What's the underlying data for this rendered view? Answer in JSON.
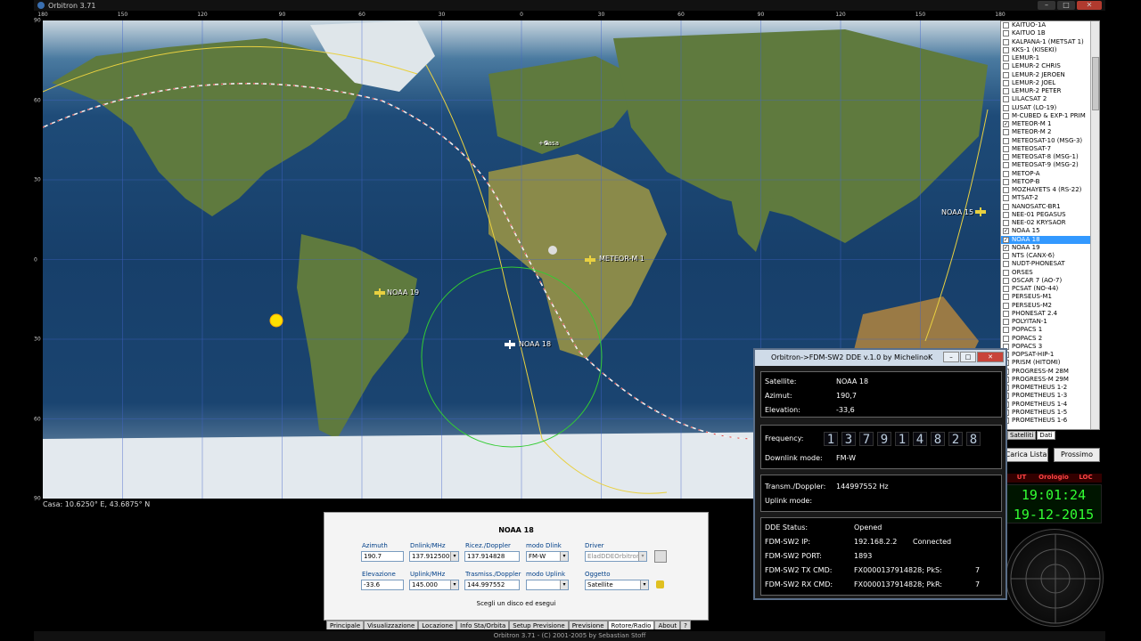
{
  "window": {
    "title": "Orbitron 3.71"
  },
  "lon_ticks": [
    "180",
    "150",
    "120",
    "90",
    "60",
    "30",
    "0",
    "30",
    "60",
    "90",
    "120",
    "150",
    "180"
  ],
  "lat_ticks": [
    "90",
    "60",
    "30",
    "0",
    "30",
    "60",
    "90"
  ],
  "satellites_on_map": [
    {
      "name": "NOAA 19",
      "color": "#f0e030"
    },
    {
      "name": "NOAA 18",
      "color": "#ffffff"
    },
    {
      "name": "METEOR-M 1",
      "color": "#f0e030"
    },
    {
      "name": "NOAA 15",
      "color": "#f0e030"
    }
  ],
  "home_label": "+Casa",
  "casa_status": "Casa: 10.6250° E, 43.6875° N",
  "sat_list": [
    {
      "name": "KAITUO-1A",
      "checked": false
    },
    {
      "name": "KAITUO 1B",
      "checked": false
    },
    {
      "name": "KALPANA-1 (METSAT 1)",
      "checked": false
    },
    {
      "name": "KKS-1 (KISEKI)",
      "checked": false
    },
    {
      "name": "LEMUR-1",
      "checked": false
    },
    {
      "name": "LEMUR-2 CHRIS",
      "checked": false
    },
    {
      "name": "LEMUR-2 JEROEN",
      "checked": false
    },
    {
      "name": "LEMUR-2 JOEL",
      "checked": false
    },
    {
      "name": "LEMUR-2 PETER",
      "checked": false
    },
    {
      "name": "LILACSAT 2",
      "checked": false
    },
    {
      "name": "LUSAT (LO-19)",
      "checked": false
    },
    {
      "name": "M-CUBED & EXP-1 PRIM",
      "checked": false
    },
    {
      "name": "METEOR-M 1",
      "checked": true
    },
    {
      "name": "METEOR-M 2",
      "checked": false
    },
    {
      "name": "METEOSAT-10 (MSG-3)",
      "checked": false
    },
    {
      "name": "METEOSAT-7",
      "checked": false
    },
    {
      "name": "METEOSAT-8 (MSG-1)",
      "checked": false
    },
    {
      "name": "METEOSAT-9 (MSG-2)",
      "checked": false
    },
    {
      "name": "METOP-A",
      "checked": false
    },
    {
      "name": "METOP-B",
      "checked": false
    },
    {
      "name": "MOZHAYETS 4 (RS-22)",
      "checked": false
    },
    {
      "name": "MTSAT-2",
      "checked": false
    },
    {
      "name": "NANOSATC-BR1",
      "checked": false
    },
    {
      "name": "NEE-01 PEGASUS",
      "checked": false
    },
    {
      "name": "NEE-02 KRYSAOR",
      "checked": false
    },
    {
      "name": "NOAA 15",
      "checked": true
    },
    {
      "name": "NOAA 18",
      "checked": true,
      "selected": true
    },
    {
      "name": "NOAA 19",
      "checked": true
    },
    {
      "name": "NTS (CANX-6)",
      "checked": false
    },
    {
      "name": "NUDT-PHONESAT",
      "checked": false
    },
    {
      "name": "ORSES",
      "checked": false
    },
    {
      "name": "OSCAR 7 (AO-7)",
      "checked": false
    },
    {
      "name": "PCSAT (NO-44)",
      "checked": false
    },
    {
      "name": "PERSEUS-M1",
      "checked": false
    },
    {
      "name": "PERSEUS-M2",
      "checked": false
    },
    {
      "name": "PHONESAT 2.4",
      "checked": false
    },
    {
      "name": "POLYITAN-1",
      "checked": false
    },
    {
      "name": "POPACS 1",
      "checked": false
    },
    {
      "name": "POPACS 2",
      "checked": false
    },
    {
      "name": "POPACS 3",
      "checked": false
    },
    {
      "name": "POPSAT-HIP-1",
      "checked": false
    },
    {
      "name": "PRISM (HITOMI)",
      "checked": false
    },
    {
      "name": "PROGRESS-M 28M",
      "checked": false
    },
    {
      "name": "PROGRESS-M 29M",
      "checked": false
    },
    {
      "name": "PROMETHEUS 1-2",
      "checked": false
    },
    {
      "name": "PROMETHEUS 1-3",
      "checked": false
    },
    {
      "name": "PROMETHEUS 1-4",
      "checked": false
    },
    {
      "name": "PROMETHEUS 1-5",
      "checked": false
    },
    {
      "name": "PROMETHEUS 1-6",
      "checked": false
    }
  ],
  "list_tabs": {
    "satelliti": "Satelliti",
    "dati": "Dati"
  },
  "buttons": {
    "carica_lista": "Carica Lista",
    "prossimo": "Prossimo"
  },
  "clock": {
    "h1": "UT",
    "h2": "Orologio",
    "h3": "LOC",
    "time": "19:01:24",
    "date": "19-12-2015"
  },
  "panel": {
    "title": "NOAA 18",
    "azimuth_label": "Azimuth",
    "azimuth": "190.7",
    "dnlink_label": "Dnlink/MHz",
    "dnlink": "137.912500",
    "ricez_label": "Ricez./Doppler",
    "ricez": "137.914828",
    "modo_dlink_label": "modo Dlink",
    "modo_dlink": "FM-W",
    "driver_label": "Driver",
    "driver": "EladDDEOrbitron",
    "elev_label": "Elevazione",
    "elev": "-33.6",
    "uplink_label": "Uplink/MHz",
    "uplink": "145.000",
    "trasm_label": "Trasmiss./Doppler",
    "trasm": "144.997552",
    "modo_uplink_label": "modo Uplink",
    "modo_uplink": "",
    "oggetto_label": "Oggetto",
    "oggetto": "Satellite",
    "hint": "Scegli un disco ed esegui"
  },
  "bottom_tabs": [
    "Principale",
    "Visualizzazione",
    "Locazione",
    "Info Sta/Orbita",
    "Setup Previsione",
    "Previsione",
    "Rotore/Radio",
    "About",
    "?"
  ],
  "statusbar": "Orbitron 3.71 - (C) 2001-2005 by Sebastian Stoff",
  "dde": {
    "title": "Orbitron->FDM-SW2 DDE v.1.0 by MichelinoK",
    "satellite_label": "Satellite:",
    "satellite": "NOAA 18",
    "azimut_label": "Azimut:",
    "azimut": "190,7",
    "elevation_label": "Elevation:",
    "elevation": "-33,6",
    "frequency_label": "Frequency:",
    "frequency_digits": [
      "1",
      "3",
      "7",
      "9",
      "1",
      "4",
      "8",
      "2",
      "8"
    ],
    "downlink_mode_label": "Downlink mode:",
    "downlink_mode": "FM-W",
    "transm_label": "Transm./Doppler:",
    "transm": "144997552 Hz",
    "uplink_mode_label": "Uplink mode:",
    "status_label": "DDE Status:",
    "status": "Opened",
    "ip_label": "FDM-SW2 IP:",
    "ip": "192.168.2.2",
    "connected": "Connected",
    "port_label": "FDM-SW2 PORT:",
    "port": "1893",
    "tx_label": "FDM-SW2 TX CMD:",
    "tx": "FX0000137914828; PkS:",
    "tx_val": "7",
    "rx_label": "FDM-SW2 RX CMD:",
    "rx": "FX0000137914828; PkR:",
    "rx_val": "7"
  }
}
